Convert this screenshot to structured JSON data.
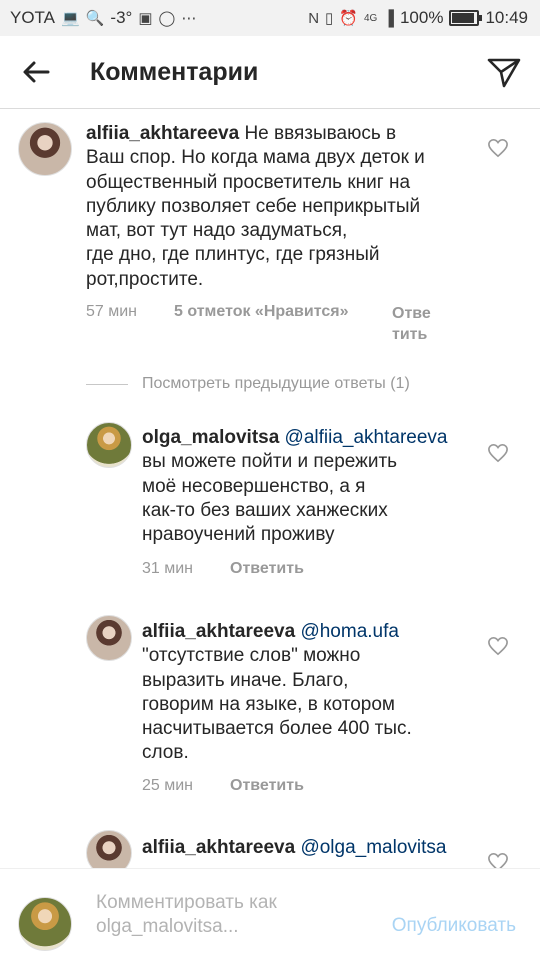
{
  "status_bar": {
    "carrier": "YOTA",
    "temp": "-3°",
    "network": "4G",
    "battery": "100%",
    "battery_level": 1.0,
    "time": "10:49"
  },
  "header": {
    "title": "Комментарии"
  },
  "comments": [
    {
      "username": "alfiia_akhtareeva",
      "text": " Не ввязываюсь в\nВаш спор. Но когда мама двух деток и\nобщественный просветитель книг на\nпублику позволяет себе неприкрытый\nмат, вот тут надо задуматься,\nгде дно, где плинтус, где грязный\nрот,простите.",
      "time": "57 мин",
      "likes": "5 отметок «Нравится»",
      "reply": "Отве\nтить"
    },
    {
      "username": "olga_malovitsa",
      "mention": " @alfiia_akhtareeva",
      "text": "\nвы можете пойти и пережить\nмоё несовершенство, а я\nкак-то без ваших ханжеских\nнравоучений проживу",
      "time": "31 мин",
      "reply": "Ответить"
    },
    {
      "username": "alfiia_akhtareeva",
      "mention": " @homa.ufa",
      "text": "\n\"отсутствие слов\" можно\nвыразить иначе. Благо,\nговорим на языке, в котором\nнасчитывается более 400 тыс.\nслов.",
      "time": "25 мин",
      "reply": "Ответить"
    },
    {
      "username": "alfiia_akhtareeva",
      "mention": " @olga_malovitsa"
    }
  ],
  "view_previous": "Посмотреть предыдущие ответы (1)",
  "composer": {
    "placeholder": "Комментировать как olga_malovitsa...",
    "publish_label": "Опубликовать"
  },
  "colors": {
    "mention": "#003569",
    "meta": "#999999",
    "publish_disabled": "#a9d4f4"
  }
}
